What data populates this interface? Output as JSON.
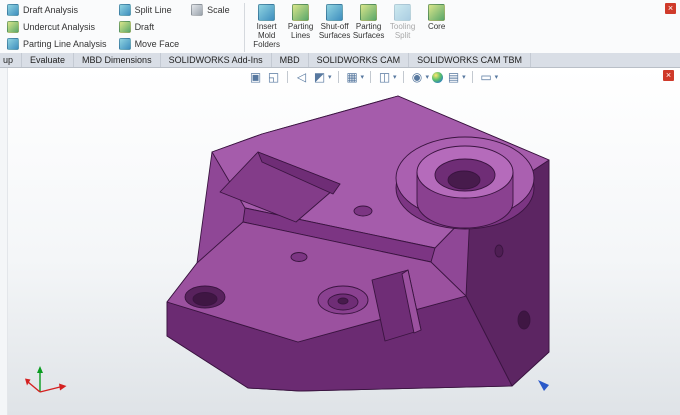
{
  "ribbon": {
    "small_buttons": [
      {
        "label": "Draft Analysis"
      },
      {
        "label": "Undercut Analysis"
      },
      {
        "label": "Parting Line Analysis"
      },
      {
        "label": "Split Line"
      },
      {
        "label": "Draft"
      },
      {
        "label": "Move Face"
      },
      {
        "label": "Scale"
      }
    ],
    "large_buttons": [
      {
        "label": "Insert Mold Folders",
        "enabled": true
      },
      {
        "label": "Parting Lines",
        "enabled": true
      },
      {
        "label": "Shut-off Surfaces",
        "enabled": true
      },
      {
        "label": "Parting Surfaces",
        "enabled": true
      },
      {
        "label": "Tooling Split",
        "enabled": false
      },
      {
        "label": "Core",
        "enabled": true
      }
    ]
  },
  "tabs": {
    "items": [
      "up",
      "Evaluate",
      "MBD Dimensions",
      "SOLIDWORKS Add-Ins",
      "MBD",
      "SOLIDWORKS CAM",
      "SOLIDWORKS CAM TBM"
    ]
  },
  "viewport_toolbar": {
    "icons": [
      {
        "name": "zoom-fit",
        "glyph": "▣"
      },
      {
        "name": "zoom-area",
        "glyph": "◱"
      },
      {
        "name": "previous-view",
        "glyph": "◁"
      },
      {
        "name": "section-view",
        "glyph": "◩"
      },
      {
        "name": "view-orientation",
        "glyph": "▦"
      },
      {
        "name": "display-style",
        "glyph": "◫"
      },
      {
        "name": "hide-show-items",
        "glyph": "◉"
      },
      {
        "name": "edit-appearance",
        "glyph": ""
      },
      {
        "name": "apply-scene",
        "glyph": "▤"
      },
      {
        "name": "view-settings",
        "glyph": "▭"
      }
    ]
  },
  "glyphs": {
    "caret": "▾",
    "close": "×"
  },
  "colors": {
    "model_top": "#a55cab",
    "model_mid": "#8f4796",
    "model_front": "#6b2b72",
    "model_right": "#5c2562",
    "close_red": "#cf3a2a",
    "hud_icon_blue": "#57789f"
  }
}
